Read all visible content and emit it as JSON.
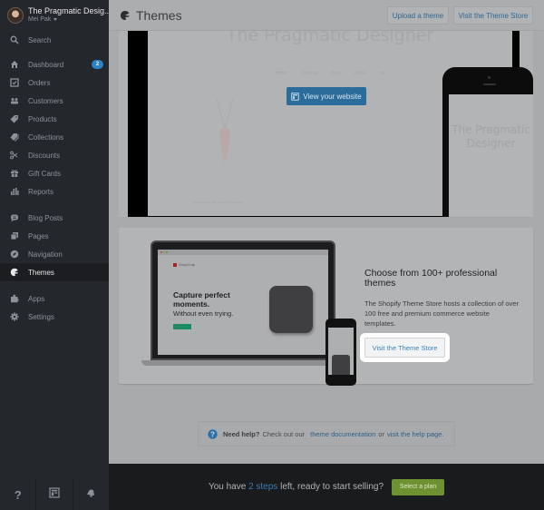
{
  "sidebar": {
    "store_name": "The Pragmatic Desig...",
    "user_name": "Mei Pak",
    "search_label": "Search",
    "items": [
      {
        "label": "Dashboard",
        "icon": "home-icon",
        "badge": "2"
      },
      {
        "label": "Orders",
        "icon": "orders-checkbox-icon"
      },
      {
        "label": "Customers",
        "icon": "customers-icon"
      },
      {
        "label": "Products",
        "icon": "tag-icon"
      },
      {
        "label": "Collections",
        "icon": "tags-icon"
      },
      {
        "label": "Discounts",
        "icon": "scissors-icon"
      },
      {
        "label": "Gift Cards",
        "icon": "gift-icon"
      },
      {
        "label": "Reports",
        "icon": "bar-chart-icon"
      },
      {
        "label": "Blog Posts",
        "icon": "blog-icon"
      },
      {
        "label": "Pages",
        "icon": "pages-icon"
      },
      {
        "label": "Navigation",
        "icon": "compass-icon"
      },
      {
        "label": "Themes",
        "icon": "palette-icon",
        "active": true
      },
      {
        "label": "Apps",
        "icon": "puzzle-icon"
      },
      {
        "label": "Settings",
        "icon": "gear-icon"
      }
    ],
    "footer": [
      {
        "icon": "help-icon",
        "glyph": "?"
      },
      {
        "icon": "storefront-icon"
      },
      {
        "icon": "notifications-icon"
      }
    ]
  },
  "header": {
    "title": "Themes",
    "upload_button": "Upload a theme",
    "visit_store_button": "Visit the Theme Store"
  },
  "preview": {
    "store_title": "The Pragmatic Designer",
    "menu": "Home Catalog Blog About us",
    "view_button": "View your website",
    "product_caption": "Watercolor ice cream necklace",
    "phone_title": "The Pragmatic Designer"
  },
  "store_card": {
    "mock_brand": "ShopCrap",
    "mock_hero_title": "Capture perfect moments.",
    "mock_hero_subtitle": "Without even trying.",
    "heading": "Choose from 100+ professional themes",
    "description": "The Shopify Theme Store hosts a collection of over 100 free and premium commerce website templates.",
    "button": "Visit the Theme Store"
  },
  "help": {
    "bold": "Need help?",
    "text1": "Check out our",
    "link1": "theme documentation",
    "text2": "or",
    "link2": "visit the help page",
    "end": "."
  },
  "bottom_bar": {
    "text_before": "You have",
    "steps": "2 steps",
    "text_after": "left, ready to start selling?",
    "button": "Select a plan"
  },
  "colors": {
    "accent_blue": "#2a84c4",
    "plan_green": "#6e9132",
    "sidebar_bg": "#24272c"
  }
}
